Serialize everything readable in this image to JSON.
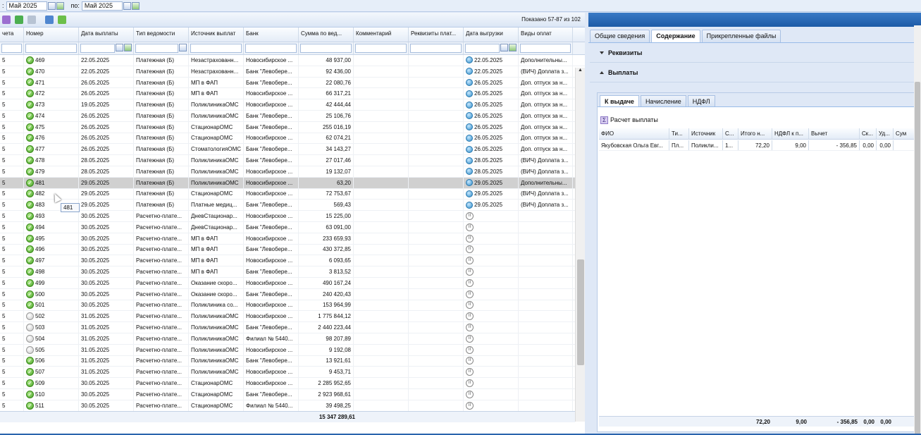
{
  "filter": {
    "from_label": ":",
    "from_value": "Май 2025",
    "to_label": "по:",
    "to_value": "Май 2025"
  },
  "toolbar": {
    "shown": "Показано 57-87 из 102"
  },
  "grid": {
    "columns": [
      "чета",
      "Номер",
      "Дата выплаты",
      "Тип ведомости",
      "Источник выплат",
      "Банк",
      "Сумма по вед...",
      "Комментарий",
      "Реквизиты плат...",
      "Дата выгрузки",
      "Виды оплат"
    ],
    "rows": [
      {
        "a": "5",
        "num": "469",
        "st": "ok",
        "date": "22.05.2025",
        "type": "Платежная (Б)",
        "src": "Незастрахованн...",
        "bank": "Новосибирское ...",
        "sum": "48 937,00",
        "ex": "b",
        "exd": "22.05.2025",
        "kind": "Дополнительны..."
      },
      {
        "a": "5",
        "num": "470",
        "st": "ok",
        "date": "22.05.2025",
        "type": "Платежная (Б)",
        "src": "Незастрахованн...",
        "bank": "Банк \"Левобере...",
        "sum": "92 436,00",
        "ex": "b",
        "exd": "22.05.2025",
        "kind": "(ВИЧ) Доплата з..."
      },
      {
        "a": "5",
        "num": "471",
        "st": "ok",
        "date": "26.05.2025",
        "type": "Платежная (Б)",
        "src": "МП в ФАП",
        "bank": "Банк \"Левобере...",
        "sum": "22 080,76",
        "ex": "b",
        "exd": "26.05.2025",
        "kind": "Доп. отпуск за н..."
      },
      {
        "a": "5",
        "num": "472",
        "st": "ok",
        "date": "26.05.2025",
        "type": "Платежная (Б)",
        "src": "МП в ФАП",
        "bank": "Новосибирское ...",
        "sum": "66 317,21",
        "ex": "b",
        "exd": "26.05.2025",
        "kind": "Доп. отпуск за н..."
      },
      {
        "a": "5",
        "num": "473",
        "st": "ok",
        "date": "19.05.2025",
        "type": "Платежная (Б)",
        "src": "ПоликлиникаОМС",
        "bank": "Новосибирское ...",
        "sum": "42 444,44",
        "ex": "b",
        "exd": "26.05.2025",
        "kind": "Доп. отпуск за н..."
      },
      {
        "a": "5",
        "num": "474",
        "st": "ok",
        "date": "26.05.2025",
        "type": "Платежная (Б)",
        "src": "ПоликлиникаОМС",
        "bank": "Банк \"Левобере...",
        "sum": "25 106,76",
        "ex": "b",
        "exd": "26.05.2025",
        "kind": "Доп. отпуск за н..."
      },
      {
        "a": "5",
        "num": "475",
        "st": "ok",
        "date": "26.05.2025",
        "type": "Платежная (Б)",
        "src": "СтационарОМС",
        "bank": "Банк \"Левобере...",
        "sum": "255 016,19",
        "ex": "b",
        "exd": "26.05.2025",
        "kind": "Доп. отпуск за н..."
      },
      {
        "a": "5",
        "num": "476",
        "st": "ok",
        "date": "26.05.2025",
        "type": "Платежная (Б)",
        "src": "СтационарОМС",
        "bank": "Новосибирское ...",
        "sum": "62 074,21",
        "ex": "b",
        "exd": "26.05.2025",
        "kind": "Доп. отпуск за н..."
      },
      {
        "a": "5",
        "num": "477",
        "st": "ok",
        "date": "26.05.2025",
        "type": "Платежная (Б)",
        "src": "СтоматологияОМС",
        "bank": "Банк \"Левобере...",
        "sum": "34 143,27",
        "ex": "b",
        "exd": "26.05.2025",
        "kind": "Доп. отпуск за н..."
      },
      {
        "a": "5",
        "num": "478",
        "st": "ok",
        "date": "28.05.2025",
        "type": "Платежная (Б)",
        "src": "ПоликлиникаОМС",
        "bank": "Банк \"Левобере...",
        "sum": "27 017,46",
        "ex": "b",
        "exd": "28.05.2025",
        "kind": "(ВИЧ) Доплата з..."
      },
      {
        "a": "5",
        "num": "479",
        "st": "ok",
        "date": "28.05.2025",
        "type": "Платежная (Б)",
        "src": "ПоликлиникаОМС",
        "bank": "Новосибирское ...",
        "sum": "19 132,07",
        "ex": "b",
        "exd": "28.05.2025",
        "kind": "(ВИЧ) Доплата з..."
      },
      {
        "a": "5",
        "num": "481",
        "st": "ok",
        "date": "29.05.2025",
        "type": "Платежная (Б)",
        "src": "ПоликлиникаОМС",
        "bank": "Новосибирское ...",
        "sum": "63,20",
        "ex": "b",
        "exd": "29.05.2025",
        "kind": "Дополнительны...",
        "sel": true
      },
      {
        "a": "5",
        "num": "482",
        "st": "ok",
        "date": "29.05.2025",
        "type": "Платежная (Б)",
        "src": "СтационарОМС",
        "bank": "Новосибирское ...",
        "sum": "72 753,67",
        "ex": "b",
        "exd": "29.05.2025",
        "kind": "(ВИЧ) Доплата з..."
      },
      {
        "a": "5",
        "num": "483",
        "st": "ok",
        "date": "29.05.2025",
        "type": "Платежная (Б)",
        "src": "Платные медиц...",
        "bank": "Банк \"Левобере...",
        "sum": "569,43",
        "ex": "b",
        "exd": "29.05.2025",
        "kind": "(ВИЧ) Доплата з..."
      },
      {
        "a": "5",
        "num": "493",
        "st": "ok",
        "date": "30.05.2025",
        "type": "Расчетно-плате...",
        "src": "ДневСтационар...",
        "bank": "Новосибирское ...",
        "sum": "15 225,00",
        "ex": "p",
        "exd": "",
        "kind": ""
      },
      {
        "a": "5",
        "num": "494",
        "st": "ok",
        "date": "30.05.2025",
        "type": "Расчетно-плате...",
        "src": "ДневСтационар...",
        "bank": "Банк \"Левобере...",
        "sum": "63 091,00",
        "ex": "p",
        "exd": "",
        "kind": ""
      },
      {
        "a": "5",
        "num": "495",
        "st": "ok",
        "date": "30.05.2025",
        "type": "Расчетно-плате...",
        "src": "МП в ФАП",
        "bank": "Новосибирское ...",
        "sum": "233 659,93",
        "ex": "p",
        "exd": "",
        "kind": ""
      },
      {
        "a": "5",
        "num": "496",
        "st": "ok",
        "date": "30.05.2025",
        "type": "Расчетно-плате...",
        "src": "МП в ФАП",
        "bank": "Банк \"Левобере...",
        "sum": "430 372,85",
        "ex": "p",
        "exd": "",
        "kind": ""
      },
      {
        "a": "5",
        "num": "497",
        "st": "ok",
        "date": "30.05.2025",
        "type": "Расчетно-плате...",
        "src": "МП в ФАП",
        "bank": "Новосибирское ...",
        "sum": "6 093,65",
        "ex": "p",
        "exd": "",
        "kind": ""
      },
      {
        "a": "5",
        "num": "498",
        "st": "ok",
        "date": "30.05.2025",
        "type": "Расчетно-плате...",
        "src": "МП в ФАП",
        "bank": "Банк \"Левобере...",
        "sum": "3 813,52",
        "ex": "p",
        "exd": "",
        "kind": ""
      },
      {
        "a": "5",
        "num": "499",
        "st": "ok",
        "date": "30.05.2025",
        "type": "Расчетно-плате...",
        "src": "Оказание скоро...",
        "bank": "Новосибирское ...",
        "sum": "490 167,24",
        "ex": "p",
        "exd": "",
        "kind": ""
      },
      {
        "a": "5",
        "num": "500",
        "st": "ok",
        "date": "30.05.2025",
        "type": "Расчетно-плате...",
        "src": "Оказание скоро...",
        "bank": "Банк \"Левобере...",
        "sum": "240 420,43",
        "ex": "p",
        "exd": "",
        "kind": ""
      },
      {
        "a": "5",
        "num": "501",
        "st": "ok",
        "date": "30.05.2025",
        "type": "Расчетно-плате...",
        "src": "Поликлиника со...",
        "bank": "Новосибирское ...",
        "sum": "153 964,99",
        "ex": "p",
        "exd": "",
        "kind": ""
      },
      {
        "a": "5",
        "num": "502",
        "st": "gray",
        "date": "31.05.2025",
        "type": "Расчетно-плате...",
        "src": "ПоликлиникаОМС",
        "bank": "Новосибирское ...",
        "sum": "1 775 844,12",
        "ex": "p",
        "exd": "",
        "kind": ""
      },
      {
        "a": "5",
        "num": "503",
        "st": "gray",
        "date": "31.05.2025",
        "type": "Расчетно-плате...",
        "src": "ПоликлиникаОМС",
        "bank": "Банк \"Левобере...",
        "sum": "2 440 223,44",
        "ex": "p",
        "exd": "",
        "kind": ""
      },
      {
        "a": "5",
        "num": "504",
        "st": "gray",
        "date": "31.05.2025",
        "type": "Расчетно-плате...",
        "src": "ПоликлиникаОМС",
        "bank": "Филиал № 5440...",
        "sum": "98 207,89",
        "ex": "p",
        "exd": "",
        "kind": ""
      },
      {
        "a": "5",
        "num": "505",
        "st": "gray",
        "date": "31.05.2025",
        "type": "Расчетно-плате...",
        "src": "ПоликлиникаОМС",
        "bank": "Новосибирское ...",
        "sum": "9 192,08",
        "ex": "p",
        "exd": "",
        "kind": ""
      },
      {
        "a": "5",
        "num": "506",
        "st": "ok",
        "date": "31.05.2025",
        "type": "Расчетно-плате...",
        "src": "ПоликлиникаОМС",
        "bank": "Банк \"Левобере...",
        "sum": "13 921,61",
        "ex": "p",
        "exd": "",
        "kind": ""
      },
      {
        "a": "5",
        "num": "507",
        "st": "ok",
        "date": "31.05.2025",
        "type": "Расчетно-плате...",
        "src": "ПоликлиникаОМС",
        "bank": "Новосибирское ...",
        "sum": "9 453,71",
        "ex": "p",
        "exd": "",
        "kind": ""
      },
      {
        "a": "5",
        "num": "509",
        "st": "ok",
        "date": "30.05.2025",
        "type": "Расчетно-плате...",
        "src": "СтационарОМС",
        "bank": "Новосибирское ...",
        "sum": "2 285 952,65",
        "ex": "p",
        "exd": "",
        "kind": ""
      },
      {
        "a": "5",
        "num": "510",
        "st": "ok",
        "date": "30.05.2025",
        "type": "Расчетно-плате...",
        "src": "СтационарОМС",
        "bank": "Банк \"Левобере...",
        "sum": "2 923 968,61",
        "ex": "p",
        "exd": "",
        "kind": ""
      },
      {
        "a": "5",
        "num": "511",
        "st": "ok",
        "date": "30.05.2025",
        "type": "Расчетно-плате...",
        "src": "СтационарОМС",
        "bank": "Филиал № 5440...",
        "sum": "39 498,25",
        "ex": "p",
        "exd": "",
        "kind": ""
      }
    ],
    "total": "15 347 289,61",
    "tooltip": "481"
  },
  "right": {
    "tabs": [
      "Общие сведения",
      "Содержание",
      "Прикрепленные файлы"
    ],
    "section_requisites": "Реквизиты",
    "section_payments": "Выплаты",
    "subtabs": [
      "К выдаче",
      "Начисление",
      "НДФЛ"
    ],
    "calc_button": "Расчет выплаты",
    "pay_columns": [
      "ФИО",
      "Ти...",
      "Источник",
      "С...",
      "Итого н...",
      "НДФЛ к п...",
      "Вычет",
      "Ск...",
      "Уд...",
      "Сум"
    ],
    "pay_row": [
      "Якубовская Ольга Евг...",
      "Пл...",
      "Поликли...",
      "1...",
      "72,20",
      "9,00",
      "- 356,85",
      "0,00",
      "0,00",
      ""
    ],
    "pay_total": [
      "",
      "",
      "",
      "",
      "72,20",
      "9,00",
      "- 356,85",
      "0,00",
      "0,00",
      ""
    ]
  }
}
